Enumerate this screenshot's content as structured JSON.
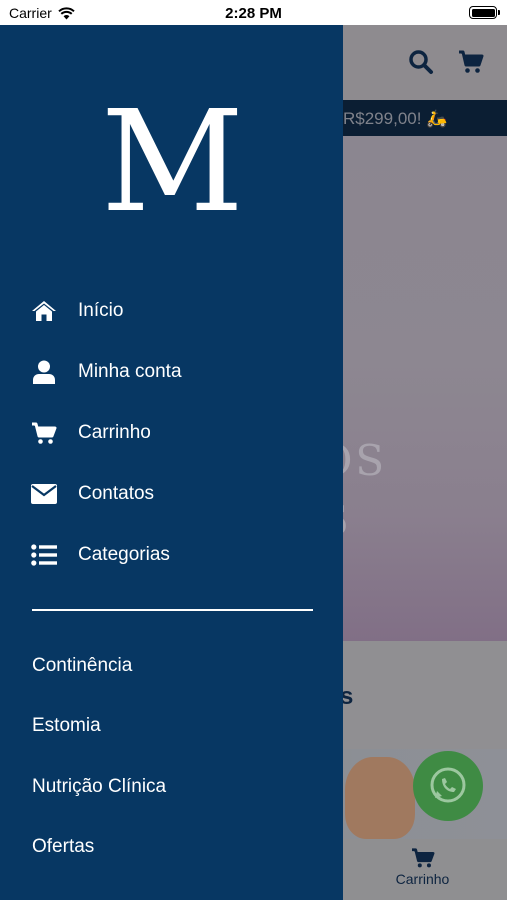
{
  "status_bar": {
    "carrier": "Carrier",
    "time": "2:28 PM"
  },
  "background_app": {
    "promo_text": "R$299,00! 🛵",
    "hero_line1": "OS",
    "hero_line2": "S",
    "section_heading": "ais",
    "tab_cart_label": "Carrinho"
  },
  "drawer": {
    "logo_letter": "M",
    "menu": [
      {
        "label": "Início",
        "icon": "home-icon"
      },
      {
        "label": "Minha conta",
        "icon": "user-icon"
      },
      {
        "label": "Carrinho",
        "icon": "cart-icon"
      },
      {
        "label": "Contatos",
        "icon": "envelope-icon"
      },
      {
        "label": "Categorias",
        "icon": "list-icon"
      }
    ],
    "categories": [
      "Continência",
      "Estomia",
      "Nutrição Clínica",
      "Ofertas"
    ]
  },
  "colors": {
    "drawer_bg": "#073763",
    "brand_dark": "#0d2440",
    "whatsapp_green": "#3f8b44"
  }
}
